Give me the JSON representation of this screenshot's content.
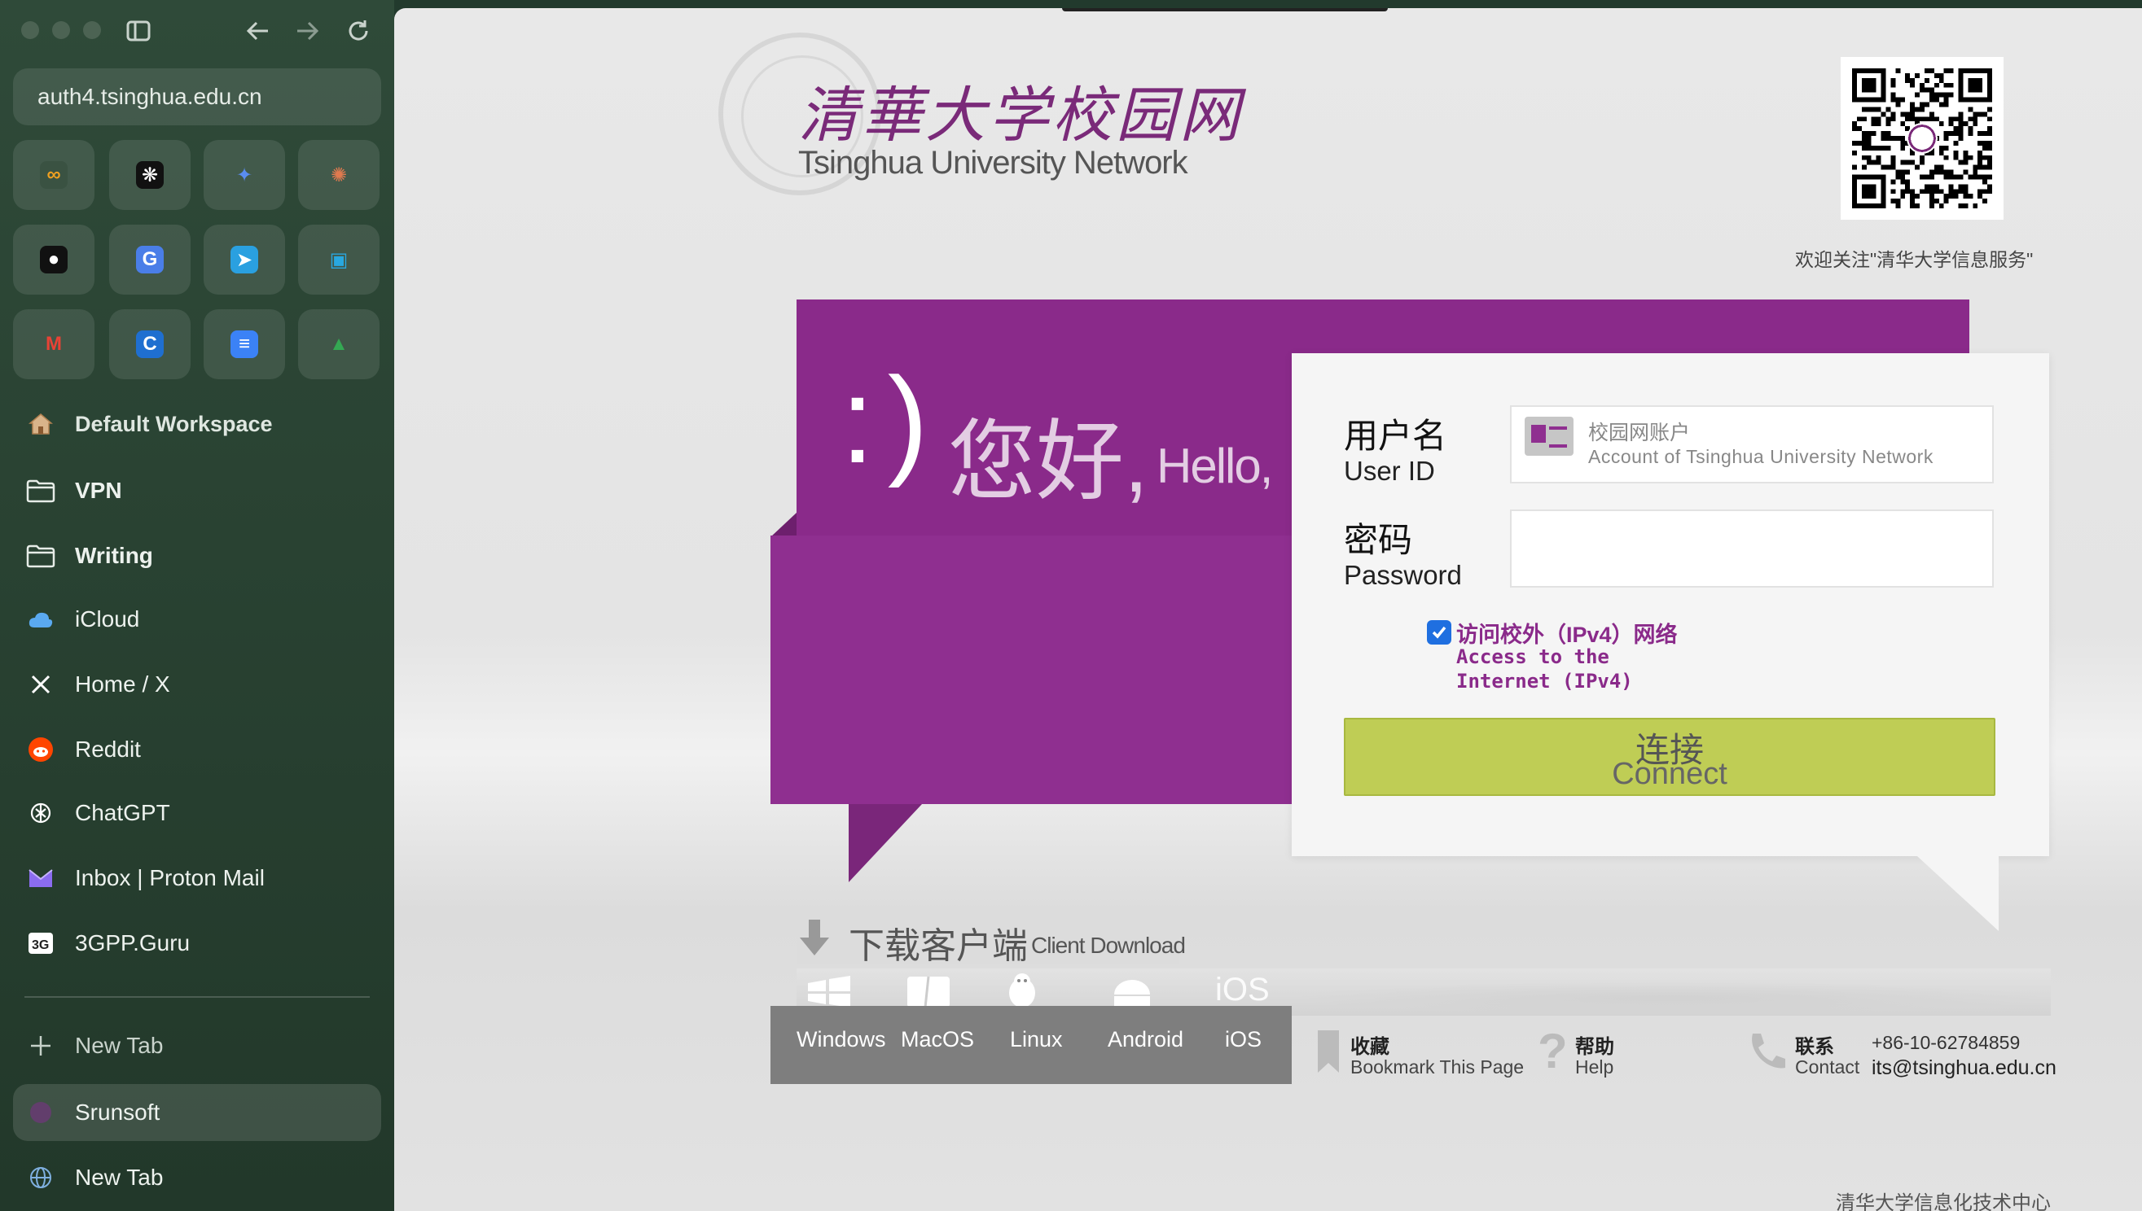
{
  "browser": {
    "url": "auth4.tsinghua.edu.cn",
    "favorites": [
      {
        "name": "loop-icon",
        "glyph": "∞",
        "color": "#f0a020",
        "bg": "#3a5242"
      },
      {
        "name": "perplexity-icon",
        "glyph": "❋",
        "color": "#ffffff",
        "bg": "#111111"
      },
      {
        "name": "gemini-icon",
        "glyph": "✦",
        "color": "#5a8cf0",
        "bg": "transparent"
      },
      {
        "name": "claude-icon",
        "glyph": "✺",
        "color": "#e07a4f",
        "bg": "transparent"
      },
      {
        "name": "github-icon",
        "glyph": "●",
        "color": "#ffffff",
        "bg": "#111111"
      },
      {
        "name": "google-translate-icon",
        "glyph": "G",
        "color": "#ffffff",
        "bg": "#4a7ee8"
      },
      {
        "name": "telegram-icon",
        "glyph": "➤",
        "color": "#ffffff",
        "bg": "#2aa0e0"
      },
      {
        "name": "bilibili-icon",
        "glyph": "▣",
        "color": "#29a8e0",
        "bg": "transparent"
      },
      {
        "name": "gmail-icon",
        "glyph": "M",
        "color": "#e94235",
        "bg": "transparent"
      },
      {
        "name": "cursor-c-icon",
        "glyph": "C",
        "color": "#ffffff",
        "bg": "#1f6fd0"
      },
      {
        "name": "google-docs-icon",
        "glyph": "≡",
        "color": "#ffffff",
        "bg": "#3b82f6"
      },
      {
        "name": "google-drive-icon",
        "glyph": "▲",
        "color": "#34a853",
        "bg": "transparent"
      }
    ],
    "workspace": "Default Workspace",
    "items": [
      {
        "label": "VPN",
        "icon": "folder-icon",
        "bold": true
      },
      {
        "label": "Writing",
        "icon": "folder-icon",
        "bold": true
      },
      {
        "label": "iCloud",
        "icon": "icloud-icon",
        "bold": false
      },
      {
        "label": "Home / X",
        "icon": "x-icon",
        "bold": false
      },
      {
        "label": "Reddit",
        "icon": "reddit-icon",
        "bold": false
      },
      {
        "label": "ChatGPT",
        "icon": "chatgpt-icon",
        "bold": false
      },
      {
        "label": "Inbox | Proton Mail",
        "icon": "proton-mail-icon",
        "bold": false
      },
      {
        "label": "3GPP.Guru",
        "icon": "3gpp-icon",
        "bold": false
      }
    ],
    "new_tab_top": "New Tab",
    "selected_tab": "Srunsoft",
    "new_tab_bottom": "New Tab"
  },
  "page": {
    "logo_cn": "清華大学校园网",
    "logo_en": "Tsinghua University Network",
    "qr_caption": "欢迎关注\"清华大学信息服务\"",
    "smile": ":)",
    "hello_cn": "您好,",
    "hello_en": "Hello,",
    "login": {
      "user_label_cn": "用户名",
      "user_label_en": "User ID",
      "user_placeholder_cn": "校园网账户",
      "user_placeholder_en": "Account of Tsinghua University Network",
      "password_label_cn": "密码",
      "password_label_en": "Password",
      "ipv4_cn": "访问校外（IPv4）网络",
      "ipv4_en": "Access to the Internet (IPv4)",
      "ipv4_checked": true,
      "connect_cn": "连接",
      "connect_en": "Connect"
    },
    "download": {
      "title_cn": "下载客户端",
      "title_en": "Client Download",
      "os": [
        "Windows",
        "MacOS",
        "Linux",
        "Android",
        "iOS"
      ],
      "os_faint_ios": "iOS"
    },
    "footer": {
      "bookmark_cn": "收藏",
      "bookmark_en": "Bookmark This Page",
      "help_cn": "帮助",
      "help_en": "Help",
      "contact_cn": "联系",
      "contact_en": "Contact",
      "phone": "+86-10-62784859",
      "email": "its@tsinghua.edu.cn",
      "copyright": "清华大学信息化技术中心"
    },
    "colors": {
      "brand_purple": "#8a2a8a",
      "connect_green": "#bfcd55"
    }
  }
}
